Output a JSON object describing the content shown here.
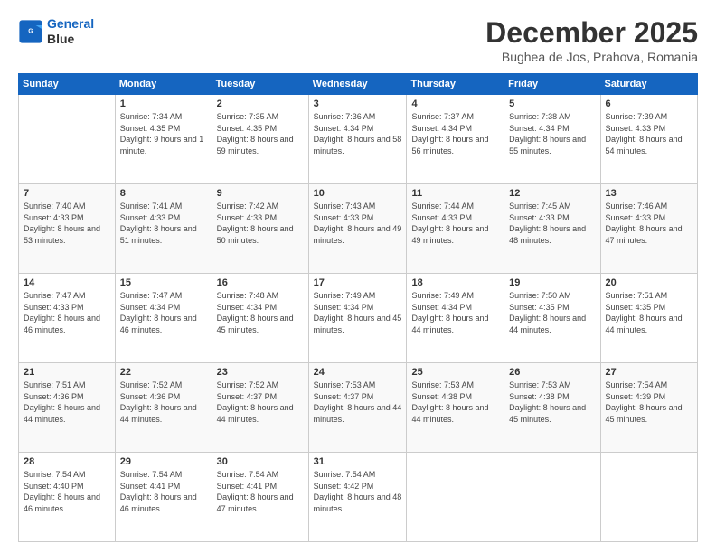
{
  "logo": {
    "line1": "General",
    "line2": "Blue"
  },
  "header": {
    "title": "December 2025",
    "subtitle": "Bughea de Jos, Prahova, Romania"
  },
  "weekdays": [
    "Sunday",
    "Monday",
    "Tuesday",
    "Wednesday",
    "Thursday",
    "Friday",
    "Saturday"
  ],
  "weeks": [
    [
      {
        "day": null,
        "sunrise": null,
        "sunset": null,
        "daylight": null
      },
      {
        "day": "1",
        "sunrise": "7:34 AM",
        "sunset": "4:35 PM",
        "daylight": "9 hours and 1 minute."
      },
      {
        "day": "2",
        "sunrise": "7:35 AM",
        "sunset": "4:35 PM",
        "daylight": "8 hours and 59 minutes."
      },
      {
        "day": "3",
        "sunrise": "7:36 AM",
        "sunset": "4:34 PM",
        "daylight": "8 hours and 58 minutes."
      },
      {
        "day": "4",
        "sunrise": "7:37 AM",
        "sunset": "4:34 PM",
        "daylight": "8 hours and 56 minutes."
      },
      {
        "day": "5",
        "sunrise": "7:38 AM",
        "sunset": "4:34 PM",
        "daylight": "8 hours and 55 minutes."
      },
      {
        "day": "6",
        "sunrise": "7:39 AM",
        "sunset": "4:33 PM",
        "daylight": "8 hours and 54 minutes."
      }
    ],
    [
      {
        "day": "7",
        "sunrise": "7:40 AM",
        "sunset": "4:33 PM",
        "daylight": "8 hours and 53 minutes."
      },
      {
        "day": "8",
        "sunrise": "7:41 AM",
        "sunset": "4:33 PM",
        "daylight": "8 hours and 51 minutes."
      },
      {
        "day": "9",
        "sunrise": "7:42 AM",
        "sunset": "4:33 PM",
        "daylight": "8 hours and 50 minutes."
      },
      {
        "day": "10",
        "sunrise": "7:43 AM",
        "sunset": "4:33 PM",
        "daylight": "8 hours and 49 minutes."
      },
      {
        "day": "11",
        "sunrise": "7:44 AM",
        "sunset": "4:33 PM",
        "daylight": "8 hours and 49 minutes."
      },
      {
        "day": "12",
        "sunrise": "7:45 AM",
        "sunset": "4:33 PM",
        "daylight": "8 hours and 48 minutes."
      },
      {
        "day": "13",
        "sunrise": "7:46 AM",
        "sunset": "4:33 PM",
        "daylight": "8 hours and 47 minutes."
      }
    ],
    [
      {
        "day": "14",
        "sunrise": "7:47 AM",
        "sunset": "4:33 PM",
        "daylight": "8 hours and 46 minutes."
      },
      {
        "day": "15",
        "sunrise": "7:47 AM",
        "sunset": "4:34 PM",
        "daylight": "8 hours and 46 minutes."
      },
      {
        "day": "16",
        "sunrise": "7:48 AM",
        "sunset": "4:34 PM",
        "daylight": "8 hours and 45 minutes."
      },
      {
        "day": "17",
        "sunrise": "7:49 AM",
        "sunset": "4:34 PM",
        "daylight": "8 hours and 45 minutes."
      },
      {
        "day": "18",
        "sunrise": "7:49 AM",
        "sunset": "4:34 PM",
        "daylight": "8 hours and 44 minutes."
      },
      {
        "day": "19",
        "sunrise": "7:50 AM",
        "sunset": "4:35 PM",
        "daylight": "8 hours and 44 minutes."
      },
      {
        "day": "20",
        "sunrise": "7:51 AM",
        "sunset": "4:35 PM",
        "daylight": "8 hours and 44 minutes."
      }
    ],
    [
      {
        "day": "21",
        "sunrise": "7:51 AM",
        "sunset": "4:36 PM",
        "daylight": "8 hours and 44 minutes."
      },
      {
        "day": "22",
        "sunrise": "7:52 AM",
        "sunset": "4:36 PM",
        "daylight": "8 hours and 44 minutes."
      },
      {
        "day": "23",
        "sunrise": "7:52 AM",
        "sunset": "4:37 PM",
        "daylight": "8 hours and 44 minutes."
      },
      {
        "day": "24",
        "sunrise": "7:53 AM",
        "sunset": "4:37 PM",
        "daylight": "8 hours and 44 minutes."
      },
      {
        "day": "25",
        "sunrise": "7:53 AM",
        "sunset": "4:38 PM",
        "daylight": "8 hours and 44 minutes."
      },
      {
        "day": "26",
        "sunrise": "7:53 AM",
        "sunset": "4:38 PM",
        "daylight": "8 hours and 45 minutes."
      },
      {
        "day": "27",
        "sunrise": "7:54 AM",
        "sunset": "4:39 PM",
        "daylight": "8 hours and 45 minutes."
      }
    ],
    [
      {
        "day": "28",
        "sunrise": "7:54 AM",
        "sunset": "4:40 PM",
        "daylight": "8 hours and 46 minutes."
      },
      {
        "day": "29",
        "sunrise": "7:54 AM",
        "sunset": "4:41 PM",
        "daylight": "8 hours and 46 minutes."
      },
      {
        "day": "30",
        "sunrise": "7:54 AM",
        "sunset": "4:41 PM",
        "daylight": "8 hours and 47 minutes."
      },
      {
        "day": "31",
        "sunrise": "7:54 AM",
        "sunset": "4:42 PM",
        "daylight": "8 hours and 48 minutes."
      },
      {
        "day": null,
        "sunrise": null,
        "sunset": null,
        "daylight": null
      },
      {
        "day": null,
        "sunrise": null,
        "sunset": null,
        "daylight": null
      },
      {
        "day": null,
        "sunrise": null,
        "sunset": null,
        "daylight": null
      }
    ]
  ],
  "labels": {
    "sunrise": "Sunrise:",
    "sunset": "Sunset:",
    "daylight": "Daylight:"
  }
}
